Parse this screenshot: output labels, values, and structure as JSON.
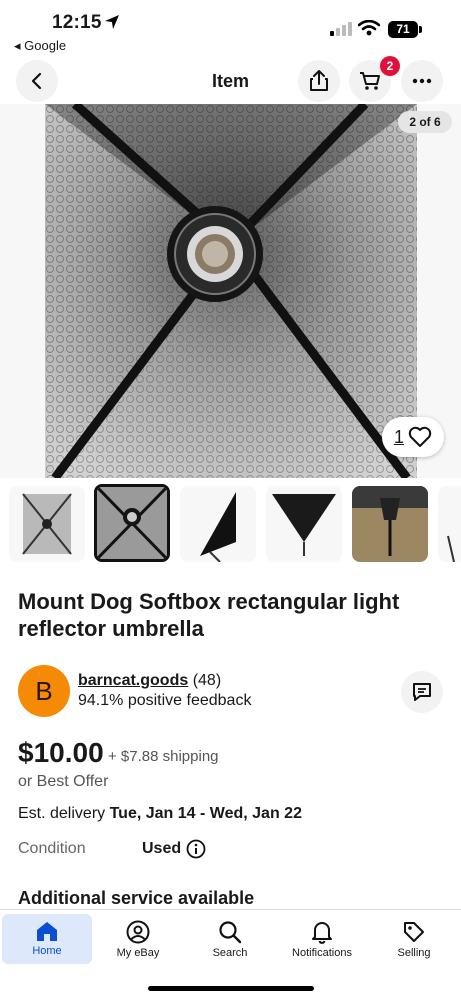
{
  "status_bar": {
    "time": "12:15",
    "battery": "71",
    "back_app": "◂ Google"
  },
  "nav": {
    "title": "Item",
    "cart_count": "2"
  },
  "gallery": {
    "counter": "2 of 6",
    "watch_count": "1"
  },
  "listing": {
    "title": " Mount Dog Softbox rectangular light reflector umbrella",
    "seller": {
      "initial": "B",
      "name": "barncat.goods",
      "rating_count": "(48)",
      "feedback": "94.1% positive feedback"
    },
    "price": "$10.00",
    "shipping": "+ $7.88 shipping",
    "best_offer": "or Best Offer",
    "delivery_label": "Est. delivery ",
    "delivery_dates": "Tue, Jan 14 - Wed, Jan 22",
    "condition_label": "Condition",
    "condition_value": "Used",
    "additional_heading": "Additional service available"
  },
  "tabs": [
    {
      "label": "Home",
      "icon": "home-icon"
    },
    {
      "label": "My eBay",
      "icon": "user-circle-icon"
    },
    {
      "label": "Search",
      "icon": "search-icon"
    },
    {
      "label": "Notifications",
      "icon": "bell-icon"
    },
    {
      "label": "Selling",
      "icon": "tag-icon"
    }
  ],
  "colors": {
    "accent": "#0b4fd1",
    "badge": "#e0103a",
    "avatar": "#f58a07"
  }
}
